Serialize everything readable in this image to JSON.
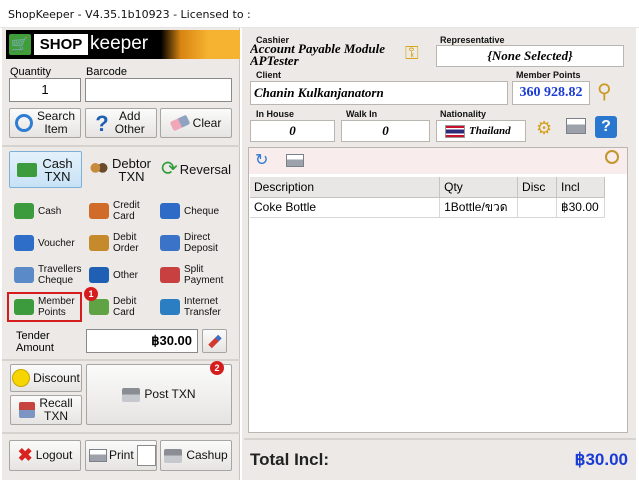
{
  "window": {
    "title": "ShopKeeper - V4.35.1b10923 - Licensed to :"
  },
  "logo": {
    "shop": "SHOP",
    "keeper": "keeper"
  },
  "entry": {
    "quantity_label": "Quantity",
    "quantity_value": "1",
    "barcode_label": "Barcode",
    "barcode_value": ""
  },
  "actions": {
    "search": "Search Item",
    "add_other": "Add Other",
    "clear": "Clear"
  },
  "txn_types": {
    "cash": "Cash TXN",
    "debtor": "Debtor TXN",
    "reversal": "Reversal"
  },
  "payment_methods": [
    {
      "label": "Cash",
      "icon": "cash-icon"
    },
    {
      "label": "Credit Card",
      "icon": "credit-card-icon"
    },
    {
      "label": "Cheque",
      "icon": "cheque-icon"
    },
    {
      "label": "Voucher",
      "icon": "voucher-icon"
    },
    {
      "label": "Debit Order",
      "icon": "debit-order-icon"
    },
    {
      "label": "Direct Deposit",
      "icon": "direct-deposit-icon"
    },
    {
      "label": "Travellers Cheque",
      "icon": "travellers-cheque-icon"
    },
    {
      "label": "Other",
      "icon": "question-icon"
    },
    {
      "label": "Split Payment",
      "icon": "split-payment-icon"
    },
    {
      "label": "Member Points",
      "icon": "member-points-icon"
    },
    {
      "label": "Debit Card",
      "icon": "debit-card-icon"
    },
    {
      "label": "Internet Transfer",
      "icon": "globe-icon"
    }
  ],
  "tender": {
    "label": "Tender Amount",
    "value": "฿30.00"
  },
  "bottom_left": {
    "discount": "Discount",
    "recall": "Recall TXN",
    "post": "Post TXN",
    "logout": "Logout",
    "print": "Print",
    "cashup": "Cashup"
  },
  "badges": {
    "one": "1",
    "two": "2"
  },
  "header": {
    "cashier_label": "Cashier",
    "cashier_line1": "Account Payable Module",
    "cashier_line2": "APTester",
    "representative_label": "Representative",
    "representative_value": "{None Selected}",
    "client_label": "Client",
    "client_value": "Chanin Kulkanjanatorn",
    "member_points_label": "Member Points",
    "member_points_value": "360 928.82",
    "in_house_label": "In House",
    "in_house_value": "0",
    "walk_in_label": "Walk In",
    "walk_in_value": "0",
    "nationality_label": "Nationality",
    "nationality_value": "Thailand"
  },
  "grid": {
    "columns": [
      "Description",
      "Qty",
      "Disc",
      "Incl"
    ],
    "rows": [
      {
        "description": "Coke Bottle",
        "qty": "1Bottle/ขวด",
        "disc": "",
        "incl": "฿30.00"
      }
    ]
  },
  "total": {
    "label": "Total Incl:",
    "value": "฿30.00"
  },
  "colors": {
    "accent_blue": "#1a3bd4",
    "highlight_red": "#d51d1d",
    "logo_orange": "#f6b331"
  }
}
